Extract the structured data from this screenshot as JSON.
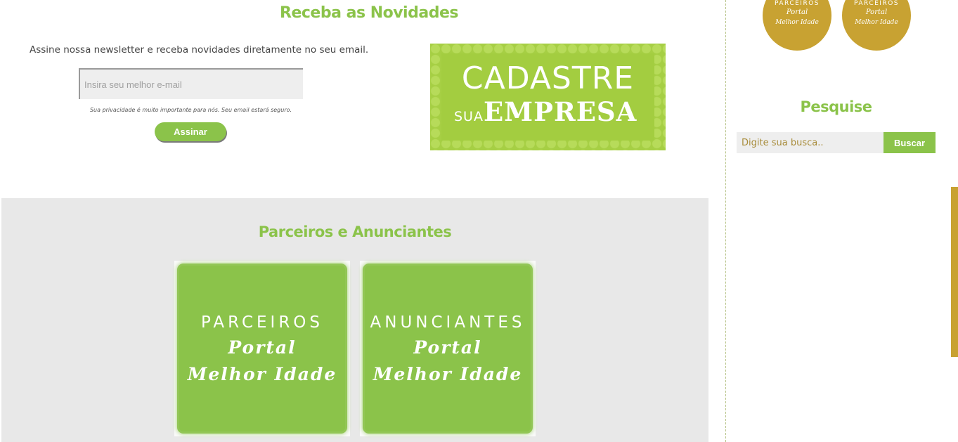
{
  "newsletter": {
    "title": "Receba as Novidades",
    "description": "Assine nossa newsletter e receba novidades diretamente no seu email.",
    "email_placeholder": "Insira seu melhor e-mail",
    "privacy_note": "Sua privacidade é muito importante para nós. Seu email estará seguro.",
    "subscribe_label": "Assinar"
  },
  "cadastre_banner": {
    "line1": "CADASTRE",
    "sua": "SUA",
    "empresa": "EMPRESA"
  },
  "partners": {
    "title": "Parceiros e Anunciantes",
    "cards": [
      {
        "caps": "PARCEIROS",
        "script1": "Portal",
        "script2": "Melhor Idade"
      },
      {
        "caps": "ANUNCIANTES",
        "script1": "Portal",
        "script2": "Melhor Idade"
      }
    ]
  },
  "sidebar": {
    "badges": [
      {
        "caps": "PARCEIROS",
        "script1": "Portal",
        "script2": "Melhor Idade"
      },
      {
        "caps": "PARCEIROS",
        "script1": "Portal",
        "script2": "Melhor Idade"
      }
    ],
    "search": {
      "title": "Pesquise",
      "placeholder": "Digite sua busca..",
      "button_label": "Buscar"
    }
  },
  "colors": {
    "accent_green": "#8bc34a",
    "gold": "#c8a232",
    "section_gray": "#e8e8e8"
  }
}
